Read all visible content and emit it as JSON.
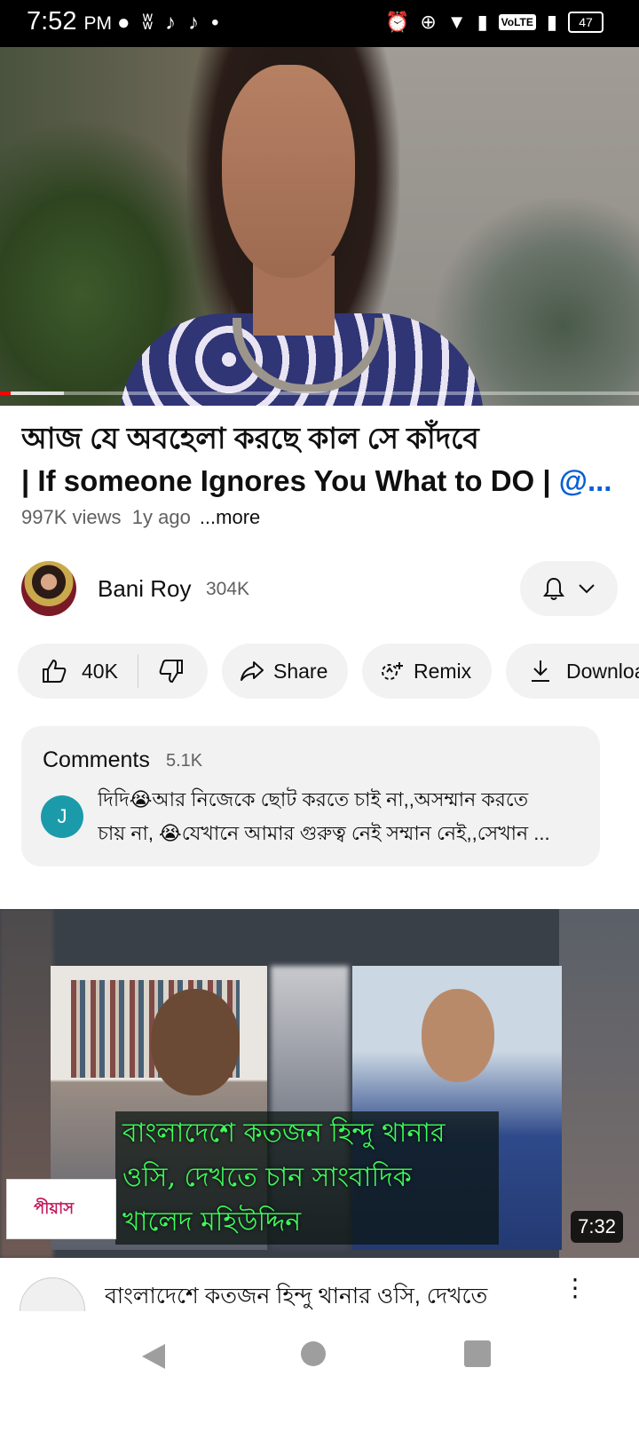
{
  "status_bar": {
    "time": "7:52",
    "ampm": "PM",
    "volte": "VoLTE",
    "battery": "47"
  },
  "video": {
    "progress_percent": 1.7,
    "buffered_percent": 10
  },
  "title": {
    "line1": "আজ যে অবহেলা করছে কাল সে কাঁদবে",
    "line2_text": "| If someone Ignores You What to DO | ",
    "line2_link": "@..."
  },
  "meta": {
    "views": "997K views",
    "age": "1y ago",
    "more": "...more"
  },
  "channel": {
    "name": "Bani Roy",
    "subscribers": "304K"
  },
  "actions": {
    "like_count": "40K",
    "share": "Share",
    "remix": "Remix",
    "download": "Download"
  },
  "comments": {
    "title": "Comments",
    "count": "5.1K",
    "avatar_letter": "J",
    "text_line1": "দিদি😭আর নিজেকে  ছোট করতে চাই না,,অসম্মান করতে",
    "text_line2": "চায় না, 😭যেখানে আমার গুরুত্ব নেই  সম্মান নেই,,সেখান ..."
  },
  "next_video": {
    "caption_line1": "বাংলাদেশে কতজন হিন্দু থানার",
    "caption_line2": "ওসি, দেখতে চান সাংবাদিক",
    "caption_line3": "খালেদ মহিউদ্দিন",
    "logo_text": "পীয়াস",
    "duration": "7:32",
    "title": "বাংলাদেশে কতজন হিন্দু থানার ওসি, দেখতে"
  },
  "colors": {
    "accent_link": "#065fd4",
    "progress": "#ff0000",
    "pill_bg": "#f2f2f2",
    "caption_green": "#3cff5a"
  }
}
